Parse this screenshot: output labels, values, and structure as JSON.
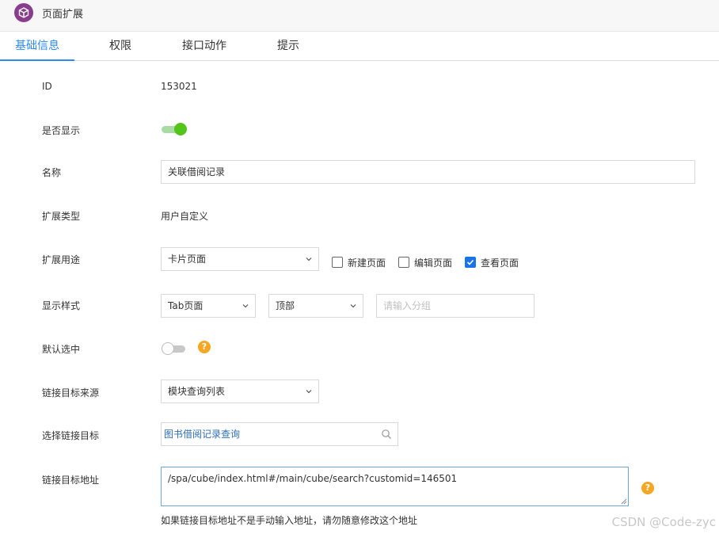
{
  "header": {
    "title": "页面扩展"
  },
  "tabs": [
    {
      "label": "基础信息",
      "active": true
    },
    {
      "label": "权限"
    },
    {
      "label": "接口动作"
    },
    {
      "label": "提示"
    }
  ],
  "form": {
    "id": {
      "label": "ID",
      "value": "153021"
    },
    "visible": {
      "label": "是否显示",
      "on": true
    },
    "name": {
      "label": "名称",
      "value": "关联借阅记录"
    },
    "ext_type": {
      "label": "扩展类型",
      "value": "用户自定义"
    },
    "usage": {
      "label": "扩展用途",
      "select_value": "卡片页面",
      "checkboxes": [
        {
          "label": "新建页面",
          "checked": false
        },
        {
          "label": "编辑页面",
          "checked": false
        },
        {
          "label": "查看页面",
          "checked": true
        }
      ]
    },
    "display_style": {
      "label": "显示样式",
      "style_value": "Tab页面",
      "position_value": "顶部",
      "group_placeholder": "请输入分组"
    },
    "default_selected": {
      "label": "默认选中",
      "on": false,
      "help": "?"
    },
    "link_source": {
      "label": "链接目标来源",
      "value": "模块查询列表"
    },
    "link_target": {
      "label": "选择链接目标",
      "value": "图书借阅记录查询"
    },
    "link_url": {
      "label": "链接目标地址",
      "value": "/spa/cube/index.html#/main/cube/search?customid=146501",
      "help": "?",
      "hint": "如果链接目标地址不是手动输入地址，请勿随意修改这个地址"
    }
  },
  "watermark": "CSDN @Code-zyc",
  "colors": {
    "accent": "#2d8cf0",
    "switch_on": "#52c41a",
    "help": "#f5a623",
    "checkbox": "#1a73e8"
  }
}
